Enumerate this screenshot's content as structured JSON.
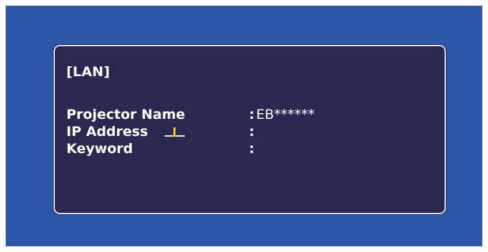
{
  "panel": {
    "title": "[LAN]",
    "rows": [
      {
        "label": "Projector Name",
        "separator": ":",
        "value": "EB******"
      },
      {
        "label": "IP Address",
        "separator": ":",
        "value": ""
      },
      {
        "label": "Keyword",
        "separator": ":",
        "value": ""
      }
    ]
  },
  "cursor_icon": "cursor-icon",
  "colors": {
    "screen_background": "#2c56a8",
    "panel_background": "#2a2750",
    "panel_border": "#dcdcf0",
    "text": "#ffffff",
    "cursor_yellow": "#f2d21e"
  }
}
